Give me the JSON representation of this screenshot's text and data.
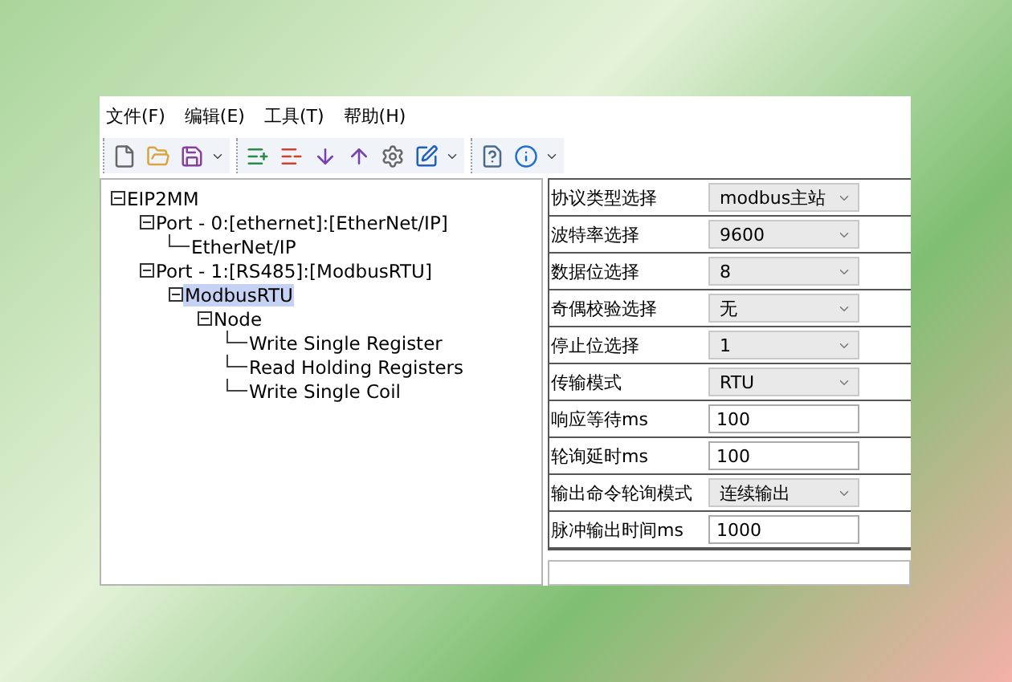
{
  "menu": [
    "文件(F)",
    "编辑(E)",
    "工具(T)",
    "帮助(H)"
  ],
  "tree": [
    {
      "label": "EIP2MM",
      "expanded": true,
      "selected": false,
      "children": [
        {
          "label": "Port - 0:[ethernet]:[EtherNet/IP]",
          "expanded": true,
          "selected": false,
          "children": [
            {
              "label": "EtherNet/IP",
              "selected": false
            }
          ]
        },
        {
          "label": "Port - 1:[RS485]:[ModbusRTU]",
          "expanded": true,
          "selected": false,
          "children": [
            {
              "label": "ModbusRTU",
              "expanded": true,
              "selected": true,
              "children": [
                {
                  "label": "Node",
                  "expanded": true,
                  "selected": false,
                  "children": [
                    {
                      "label": "Write Single Register",
                      "selected": false
                    },
                    {
                      "label": "Read Holding Registers",
                      "selected": false
                    },
                    {
                      "label": "Write Single Coil",
                      "selected": false
                    }
                  ]
                }
              ]
            }
          ]
        }
      ]
    }
  ],
  "properties": [
    {
      "label": "协议类型选择",
      "value": "modbus主站",
      "kind": "select"
    },
    {
      "label": "波特率选择",
      "value": "9600",
      "kind": "select"
    },
    {
      "label": "数据位选择",
      "value": "8",
      "kind": "select"
    },
    {
      "label": "奇偶校验选择",
      "value": "无",
      "kind": "select"
    },
    {
      "label": "停止位选择",
      "value": "1",
      "kind": "select"
    },
    {
      "label": "传输模式",
      "value": "RTU",
      "kind": "select"
    },
    {
      "label": "响应等待ms",
      "value": "100",
      "kind": "input"
    },
    {
      "label": "轮询延时ms",
      "value": "100",
      "kind": "input"
    },
    {
      "label": "输出命令轮询模式",
      "value": "连续输出",
      "kind": "select"
    },
    {
      "label": "脉冲输出时间ms",
      "value": "1000",
      "kind": "input"
    }
  ]
}
